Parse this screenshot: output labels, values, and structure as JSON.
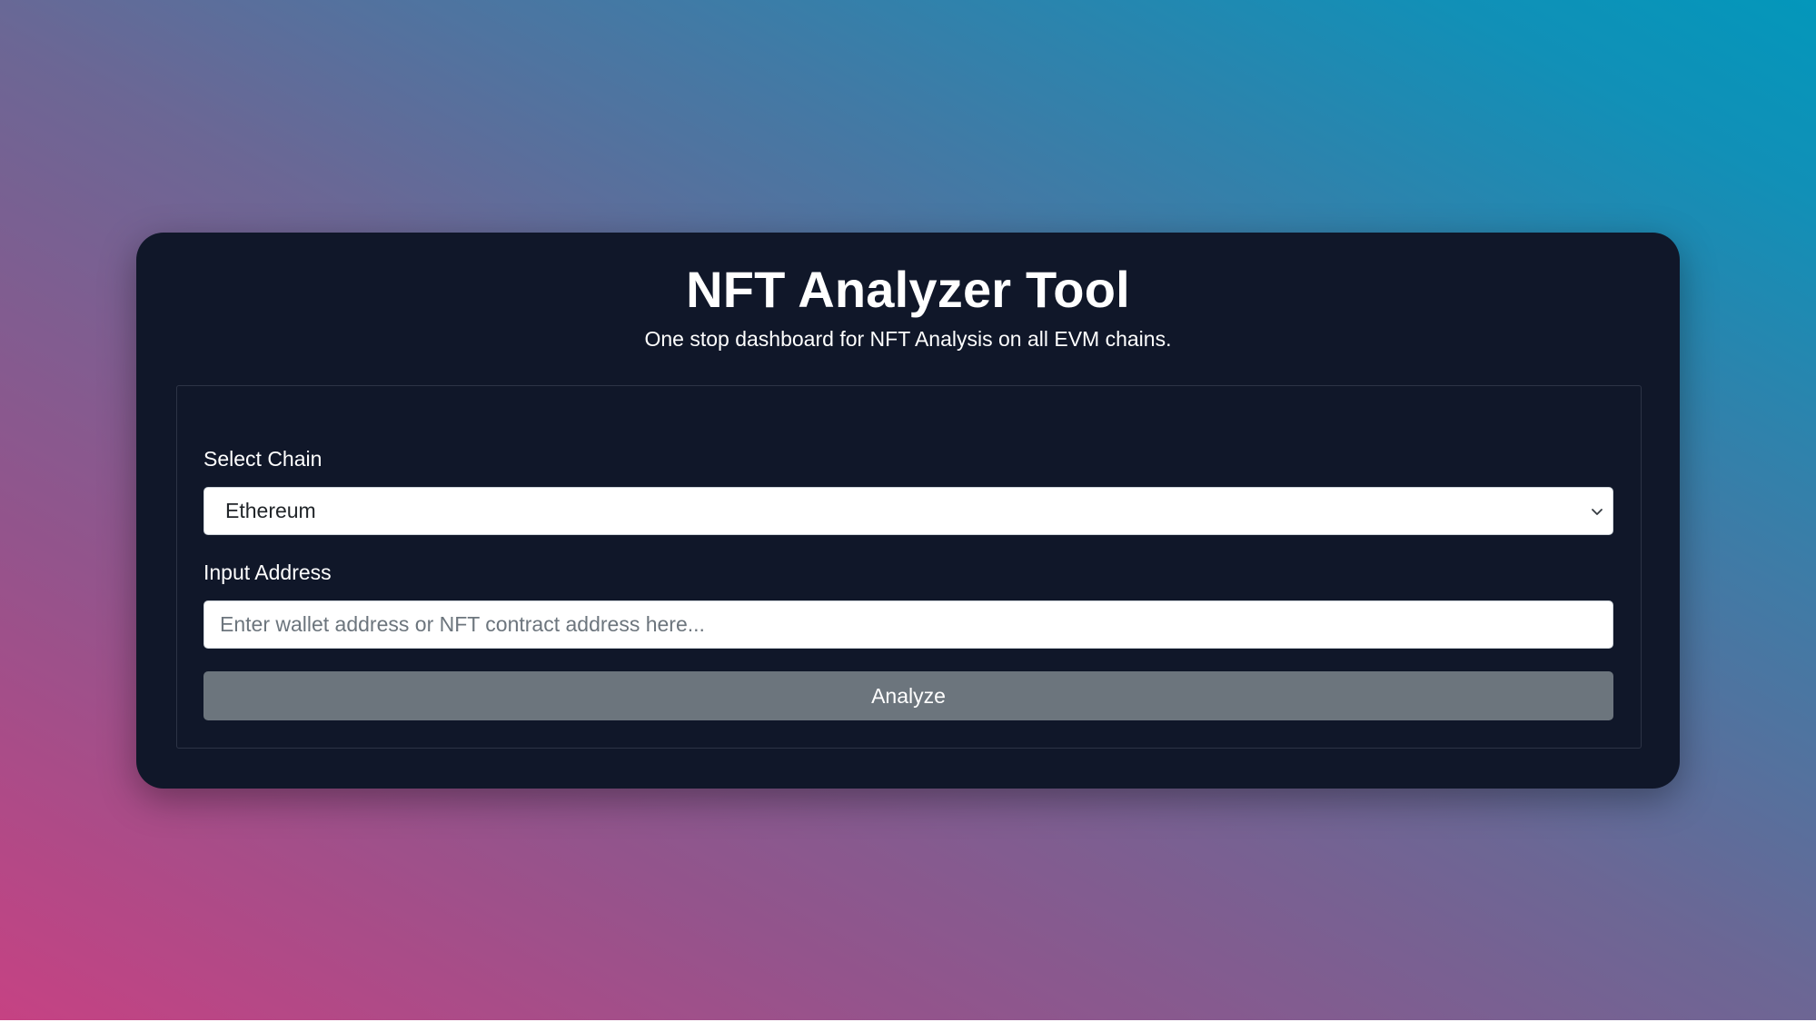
{
  "app": {
    "title": "NFT Analyzer Tool",
    "subtitle": "One stop dashboard for NFT Analysis on all EVM chains."
  },
  "form": {
    "chain_label": "Select Chain",
    "chain_selected": "Ethereum",
    "address_label": "Input Address",
    "address_value": "",
    "address_placeholder": "Enter wallet address or NFT contract address here...",
    "submit_label": "Analyze"
  },
  "icons": {
    "select_arrow": "chevron-down-icon"
  },
  "colors": {
    "card_background": "#101729",
    "button_background": "#6c757d",
    "text_primary": "#ffffff",
    "gradient_pink": "#c64283",
    "gradient_teal": "#0397bb"
  }
}
